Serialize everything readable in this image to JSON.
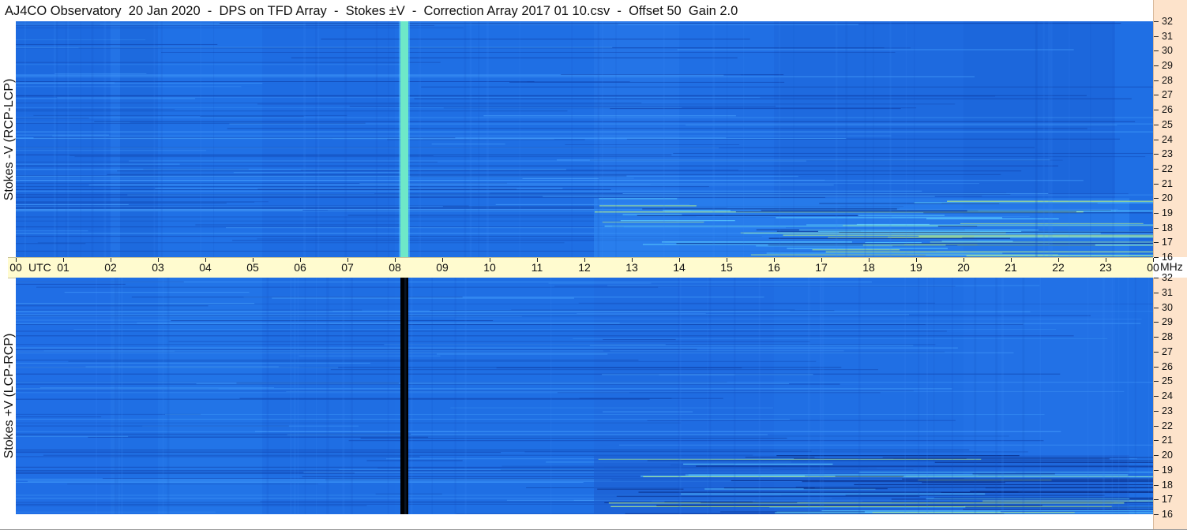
{
  "header": {
    "title": "AJ4CO Observatory  20 Jan 2020  -  DPS on TFD Array  -  Stokes ±V  -  Correction Array 2017 01 10.csv  -  Offset 50  Gain 2.0"
  },
  "chart_data": [
    {
      "type": "heatmap",
      "title": "",
      "ylabel": "Stokes -V (RCP-LCP)",
      "xlabel": "UTC",
      "x_unit": "UTC",
      "x_range": [
        0,
        24
      ],
      "y_unit": "MHz",
      "y_range": [
        16,
        32
      ],
      "y_ticks": [
        "32",
        "31",
        "30",
        "29",
        "28",
        "27",
        "26",
        "25",
        "24",
        "23",
        "22",
        "21",
        "20",
        "19",
        "18",
        "17",
        "16"
      ],
      "base_color": "#1f6fe4",
      "features": [
        {
          "kind": "vertical_line",
          "utc": 8.2,
          "color": "#6ee8c8"
        },
        {
          "kind": "broadband_activity",
          "utc_start": 12.2,
          "utc_end": 23.5,
          "freq_max": 20
        }
      ]
    },
    {
      "type": "heatmap",
      "title": "",
      "ylabel": "Stokes +V (LCP-RCP)",
      "xlabel": "UTC",
      "x_unit": "UTC",
      "x_range": [
        0,
        24
      ],
      "y_unit": "MHz",
      "y_range": [
        16,
        32
      ],
      "y_ticks": [
        "32",
        "31",
        "30",
        "29",
        "28",
        "27",
        "26",
        "25",
        "24",
        "23",
        "22",
        "21",
        "20",
        "19",
        "18",
        "17",
        "16"
      ],
      "base_color": "#1f6fe4",
      "features": [
        {
          "kind": "vertical_line",
          "utc": 8.2,
          "color": "#000000"
        },
        {
          "kind": "broadband_activity",
          "utc_start": 12.2,
          "utc_end": 23.5,
          "freq_max": 20
        }
      ]
    }
  ],
  "time_axis": {
    "labels": [
      "00",
      "01",
      "02",
      "03",
      "04",
      "05",
      "06",
      "07",
      "08",
      "09",
      "10",
      "11",
      "12",
      "13",
      "14",
      "15",
      "16",
      "17",
      "18",
      "19",
      "20",
      "21",
      "22",
      "23",
      "00"
    ],
    "utc_label": "UTC",
    "unit_label": "MHz"
  }
}
